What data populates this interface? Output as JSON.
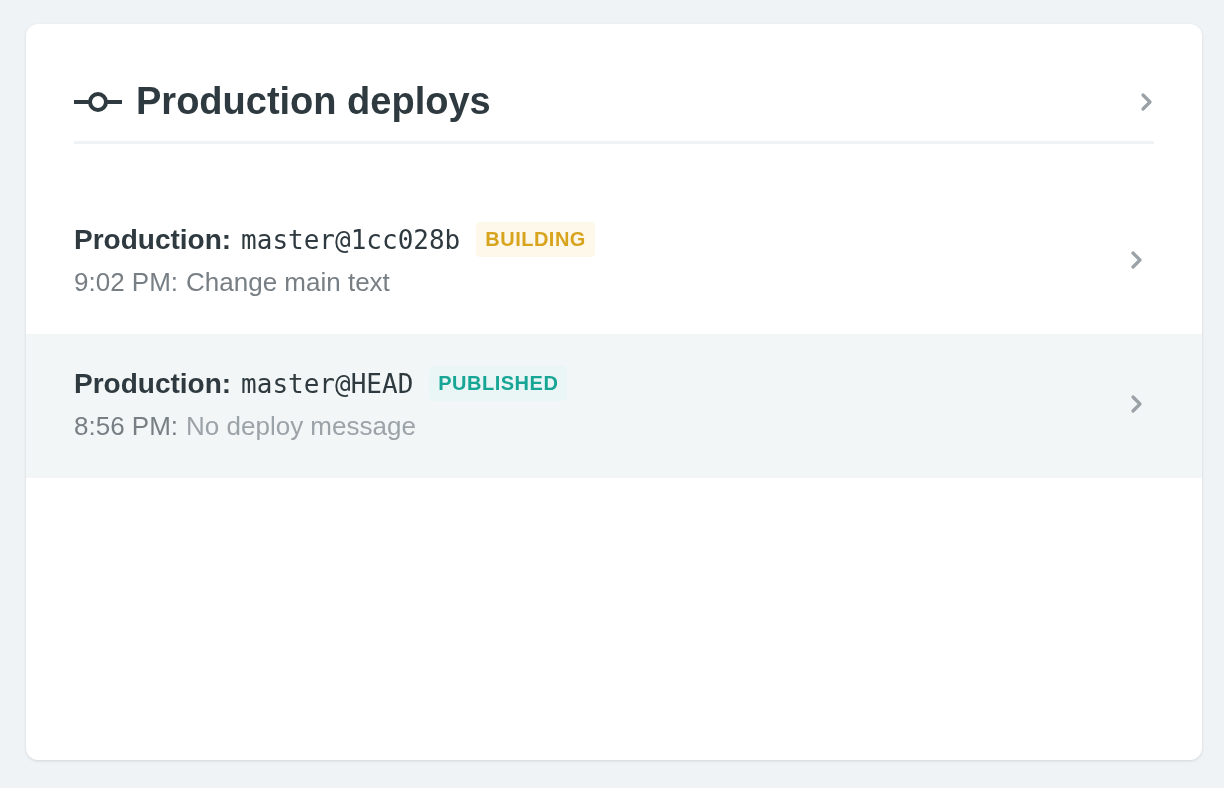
{
  "card": {
    "title": "Production deploys"
  },
  "deploys": [
    {
      "context": "Production:",
      "ref": "master@1cc028b",
      "status": {
        "kind": "building",
        "label": "BUILDING"
      },
      "time": "9:02 PM:",
      "message": "Change main text",
      "message_muted": false,
      "highlighted": false
    },
    {
      "context": "Production:",
      "ref": "master@HEAD",
      "status": {
        "kind": "published",
        "label": "PUBLISHED"
      },
      "time": "8:56 PM:",
      "message": "No deploy message",
      "message_muted": true,
      "highlighted": true
    }
  ]
}
